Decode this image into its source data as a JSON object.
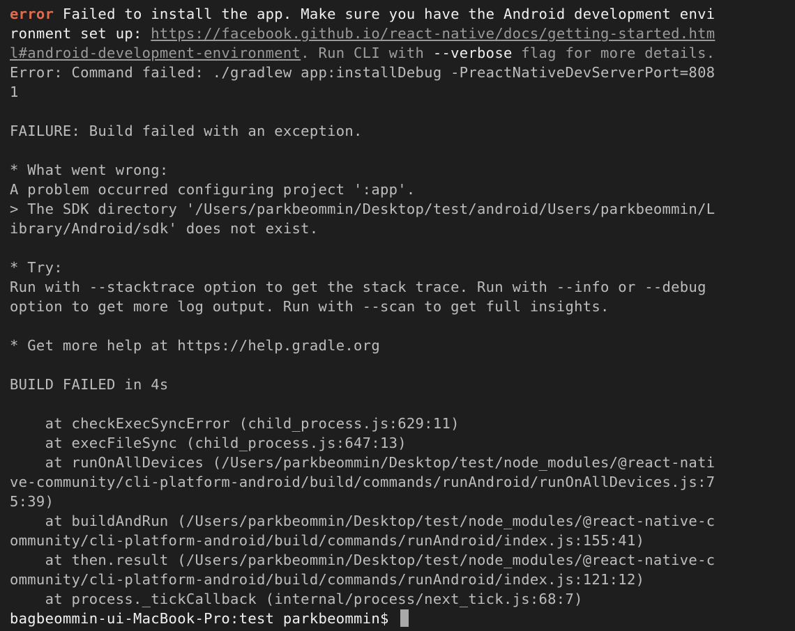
{
  "error": {
    "label": "error",
    "msg1": " Failed to install the app. Make sure you have the Android development envi",
    "msg2": "ronment set up: ",
    "link1": "https://facebook.github.io/react-native/docs/getting-started.htm",
    "link2": "l#android-development-environment",
    "tail_a": ". Run CLI with ",
    "flag": "--verbose",
    "tail_b": " flag for more details.",
    "command1": "Error: Command failed: ./gradlew app:installDebug -PreactNativeDevServerPort=808",
    "command2": "1"
  },
  "gradle": {
    "failure": "FAILURE: Build failed with an exception.",
    "wrong_head": "* What went wrong:",
    "wrong1": "A problem occurred configuring project ':app'.",
    "wrong2": "> The SDK directory '/Users/parkbeommin/Desktop/test/android/Users/parkbeommin/L",
    "wrong3": "ibrary/Android/sdk' does not exist.",
    "try_head": "* Try:",
    "try1": "Run with --stacktrace option to get the stack trace. Run with --info or --debug",
    "try2": "option to get more log output. Run with --scan to get full insights.",
    "help": "* Get more help at https://help.gradle.org",
    "build_failed": "BUILD FAILED in 4s"
  },
  "stack": [
    "    at checkExecSyncError (child_process.js:629:11)",
    "    at execFileSync (child_process.js:647:13)",
    "    at runOnAllDevices (/Users/parkbeommin/Desktop/test/node_modules/@react-nati",
    "ve-community/cli-platform-android/build/commands/runAndroid/runOnAllDevices.js:7",
    "5:39)",
    "    at buildAndRun (/Users/parkbeommin/Desktop/test/node_modules/@react-native-c",
    "ommunity/cli-platform-android/build/commands/runAndroid/index.js:155:41)",
    "    at then.result (/Users/parkbeommin/Desktop/test/node_modules/@react-native-c",
    "ommunity/cli-platform-android/build/commands/runAndroid/index.js:121:12)",
    "    at process._tickCallback (internal/process/next_tick.js:68:7)"
  ],
  "prompt": {
    "text": "bagbeommin-ui-MacBook-Pro:test parkbeommin$ "
  },
  "colors": {
    "background": "#1e1e1e",
    "text": "#bdbdbd",
    "error_label": "#e06c4f",
    "bright": "#f0f0f0"
  }
}
